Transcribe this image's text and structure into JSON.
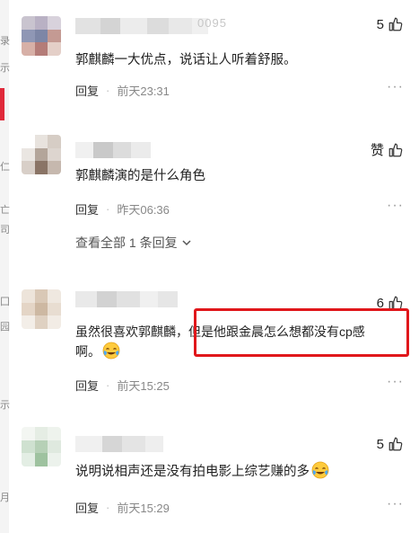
{
  "left_strip": {
    "fragments": [
      "录",
      "示",
      "仁",
      "亡",
      "司",
      "囗",
      "园",
      "示",
      "月"
    ]
  },
  "comments": [
    {
      "name_tail": "0095",
      "likes": "5",
      "text": "郭麒麟一大优点，说话让人听着舒服。",
      "reply_label": "回复",
      "time": "前天23:31",
      "more": "···"
    },
    {
      "likes": "赞",
      "text": "郭麒麟演的是什么角色",
      "reply_label": "回复",
      "time": "昨天06:36",
      "more": "···",
      "view_replies": "查看全部 1 条回复"
    },
    {
      "likes": "6",
      "text_line1": "虽然很喜欢郭麒麟，但是他跟金晨怎么想都没有cp感",
      "text_line2": "啊。",
      "reply_label": "回复",
      "time": "前天15:25",
      "more": "···"
    },
    {
      "likes": "5",
      "text": "说明说相声还是没有拍电影上综艺赚的多",
      "reply_label": "回复",
      "time": "前天15:29",
      "more": "···"
    }
  ],
  "icons": {
    "like": "thumbs-up-icon",
    "chevron": "chevron-down-icon",
    "emoji": "crying-laughing-emoji"
  },
  "colors": {
    "highlight": "#e0171b",
    "meta": "#888888"
  }
}
